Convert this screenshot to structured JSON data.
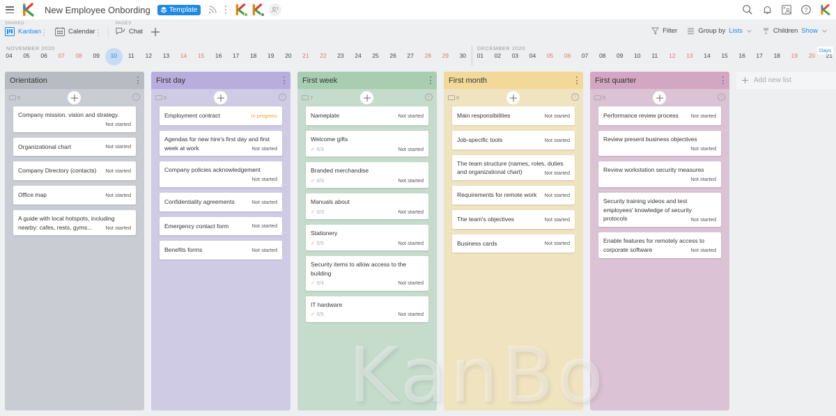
{
  "app": {
    "title": "New Employee Onbording",
    "template_badge": "Template"
  },
  "toolbar": {
    "shared_label": "SHARED",
    "pages_label": "PAGES",
    "views": [
      {
        "label": "Kanban",
        "icon": "kanban-icon",
        "active": true
      },
      {
        "label": "Calendar",
        "icon": "calendar-icon",
        "active": false
      },
      {
        "label": "Chat",
        "icon": "chat-icon",
        "active": false
      }
    ],
    "filter_label": "Filter",
    "group_by_label": "Group by",
    "group_by_value": "Lists",
    "children_label": "Children",
    "children_value": "Show"
  },
  "timeline": {
    "months": [
      "NOVEMBER 2020",
      "DECEMBER 2020"
    ],
    "days_button": "Days",
    "days": [
      {
        "d": "04",
        "t": "n"
      },
      {
        "d": "05",
        "t": "n"
      },
      {
        "d": "06",
        "t": "n"
      },
      {
        "d": "07",
        "t": "w"
      },
      {
        "d": "08",
        "t": "w"
      },
      {
        "d": "09",
        "t": "n"
      },
      {
        "d": "10",
        "t": "today"
      },
      {
        "d": "11",
        "t": "n"
      },
      {
        "d": "12",
        "t": "n"
      },
      {
        "d": "13",
        "t": "n"
      },
      {
        "d": "14",
        "t": "w"
      },
      {
        "d": "15",
        "t": "w"
      },
      {
        "d": "16",
        "t": "n"
      },
      {
        "d": "17",
        "t": "n"
      },
      {
        "d": "18",
        "t": "n"
      },
      {
        "d": "19",
        "t": "n"
      },
      {
        "d": "20",
        "t": "n"
      },
      {
        "d": "21",
        "t": "w"
      },
      {
        "d": "22",
        "t": "w"
      },
      {
        "d": "23",
        "t": "n"
      },
      {
        "d": "24",
        "t": "n"
      },
      {
        "d": "25",
        "t": "n"
      },
      {
        "d": "26",
        "t": "n"
      },
      {
        "d": "27",
        "t": "n"
      },
      {
        "d": "28",
        "t": "w"
      },
      {
        "d": "29",
        "t": "w"
      },
      {
        "d": "30",
        "t": "n"
      },
      {
        "d": "01",
        "t": "n"
      },
      {
        "d": "02",
        "t": "n"
      },
      {
        "d": "03",
        "t": "n"
      },
      {
        "d": "04",
        "t": "n"
      },
      {
        "d": "05",
        "t": "w"
      },
      {
        "d": "06",
        "t": "w"
      },
      {
        "d": "07",
        "t": "n"
      },
      {
        "d": "08",
        "t": "n"
      },
      {
        "d": "09",
        "t": "n"
      },
      {
        "d": "10",
        "t": "n"
      },
      {
        "d": "11",
        "t": "n"
      },
      {
        "d": "12",
        "t": "w"
      },
      {
        "d": "13",
        "t": "w"
      },
      {
        "d": "14",
        "t": "n"
      },
      {
        "d": "15",
        "t": "n"
      },
      {
        "d": "16",
        "t": "n"
      },
      {
        "d": "17",
        "t": "n"
      },
      {
        "d": "18",
        "t": "n"
      },
      {
        "d": "19",
        "t": "w"
      },
      {
        "d": "20",
        "t": "w"
      },
      {
        "d": "21",
        "t": "n"
      }
    ]
  },
  "board": {
    "add_list_label": "Add new list",
    "columns": [
      {
        "name": "Orientation",
        "count": "5",
        "head_color": "#b8bcc2",
        "body_color": "#c9ccd2",
        "cards": [
          {
            "title": "Company mission, vision and strategy.",
            "status": "Not started",
            "layout": "wrap"
          },
          {
            "title": "Organizational chart",
            "status": "Not started",
            "layout": "single"
          },
          {
            "title": "Company Directory (contacts)",
            "status": "Not started",
            "layout": "single"
          },
          {
            "title": "Office map",
            "status": "Not started",
            "layout": "single"
          },
          {
            "title": "A guide with local hotspots, including nearby: cafes, rests, gyms...",
            "status": "Not started",
            "layout": "inline"
          }
        ]
      },
      {
        "name": "First day",
        "count": "6",
        "head_color": "#b8aedd",
        "body_color": "#d0cbe4",
        "cards": [
          {
            "title": "Employment contract",
            "status": "In progress",
            "layout": "single",
            "inprogress": true
          },
          {
            "title": "Agendas for new hire's first day and first week at work",
            "status": "Not started",
            "layout": "inline"
          },
          {
            "title": "Company policies acknowledgement",
            "status": "Not started",
            "layout": "wrap"
          },
          {
            "title": "Confidentiality agreements",
            "status": "Not started",
            "layout": "single"
          },
          {
            "title": "Emergency contact form",
            "status": "Not started",
            "layout": "single"
          },
          {
            "title": "Benefits forms",
            "status": "Not started",
            "layout": "single"
          }
        ]
      },
      {
        "name": "First week",
        "count": "7",
        "head_color": "#a9cdb0",
        "body_color": "#c5dbcc",
        "cards": [
          {
            "title": "Nameplate",
            "status": "Not started",
            "layout": "single"
          },
          {
            "title": "Welcome gifts",
            "status": "Not started",
            "layout": "check",
            "check": "0/3"
          },
          {
            "title": "Branded merchandise",
            "status": "Not started",
            "layout": "check",
            "check": "0/3"
          },
          {
            "title": "Manuals about",
            "status": "Not started",
            "layout": "check",
            "check": "0/3"
          },
          {
            "title": "Stationery",
            "status": "Not started",
            "layout": "check",
            "check": "0/5"
          },
          {
            "title": "Security items to allow access to the building",
            "status": "Not started",
            "layout": "check",
            "check": "0/4"
          },
          {
            "title": "IT hardware",
            "status": "Not started",
            "layout": "check",
            "check": "0/5"
          }
        ]
      },
      {
        "name": "First month",
        "count": "6",
        "head_color": "#f2d99a",
        "body_color": "#f0e3c0",
        "cards": [
          {
            "title": "Main responsibilities",
            "status": "Not started",
            "layout": "single"
          },
          {
            "title": "Job-specific tools",
            "status": "Not started",
            "layout": "single"
          },
          {
            "title": "The team structure (names, roles, duties and organizational chart)",
            "status": "Not started",
            "layout": "inline"
          },
          {
            "title": "Requirements for remote work",
            "status": "Not started",
            "layout": "single"
          },
          {
            "title": "The team's objectives",
            "status": "Not started",
            "layout": "single"
          },
          {
            "title": "Business cards",
            "status": "Not started",
            "layout": "single"
          }
        ]
      },
      {
        "name": "First quarter",
        "count": "5",
        "head_color": "#d3a7c1",
        "body_color": "#dbc2d4",
        "cards": [
          {
            "title": "Performance review process",
            "status": "Not started",
            "layout": "single"
          },
          {
            "title": "Review present business objectives",
            "status": "Not started",
            "layout": "wrap"
          },
          {
            "title": "Review workstation security measures",
            "status": "Not started",
            "layout": "wrap"
          },
          {
            "title": "Security training videos and test employees' knowledge of security protocols",
            "status": "Not started",
            "layout": "inline"
          },
          {
            "title": "Enable features for remotely access to corporate software",
            "status": "Not started",
            "layout": "inline"
          }
        ]
      }
    ]
  },
  "watermark": "KanBo"
}
